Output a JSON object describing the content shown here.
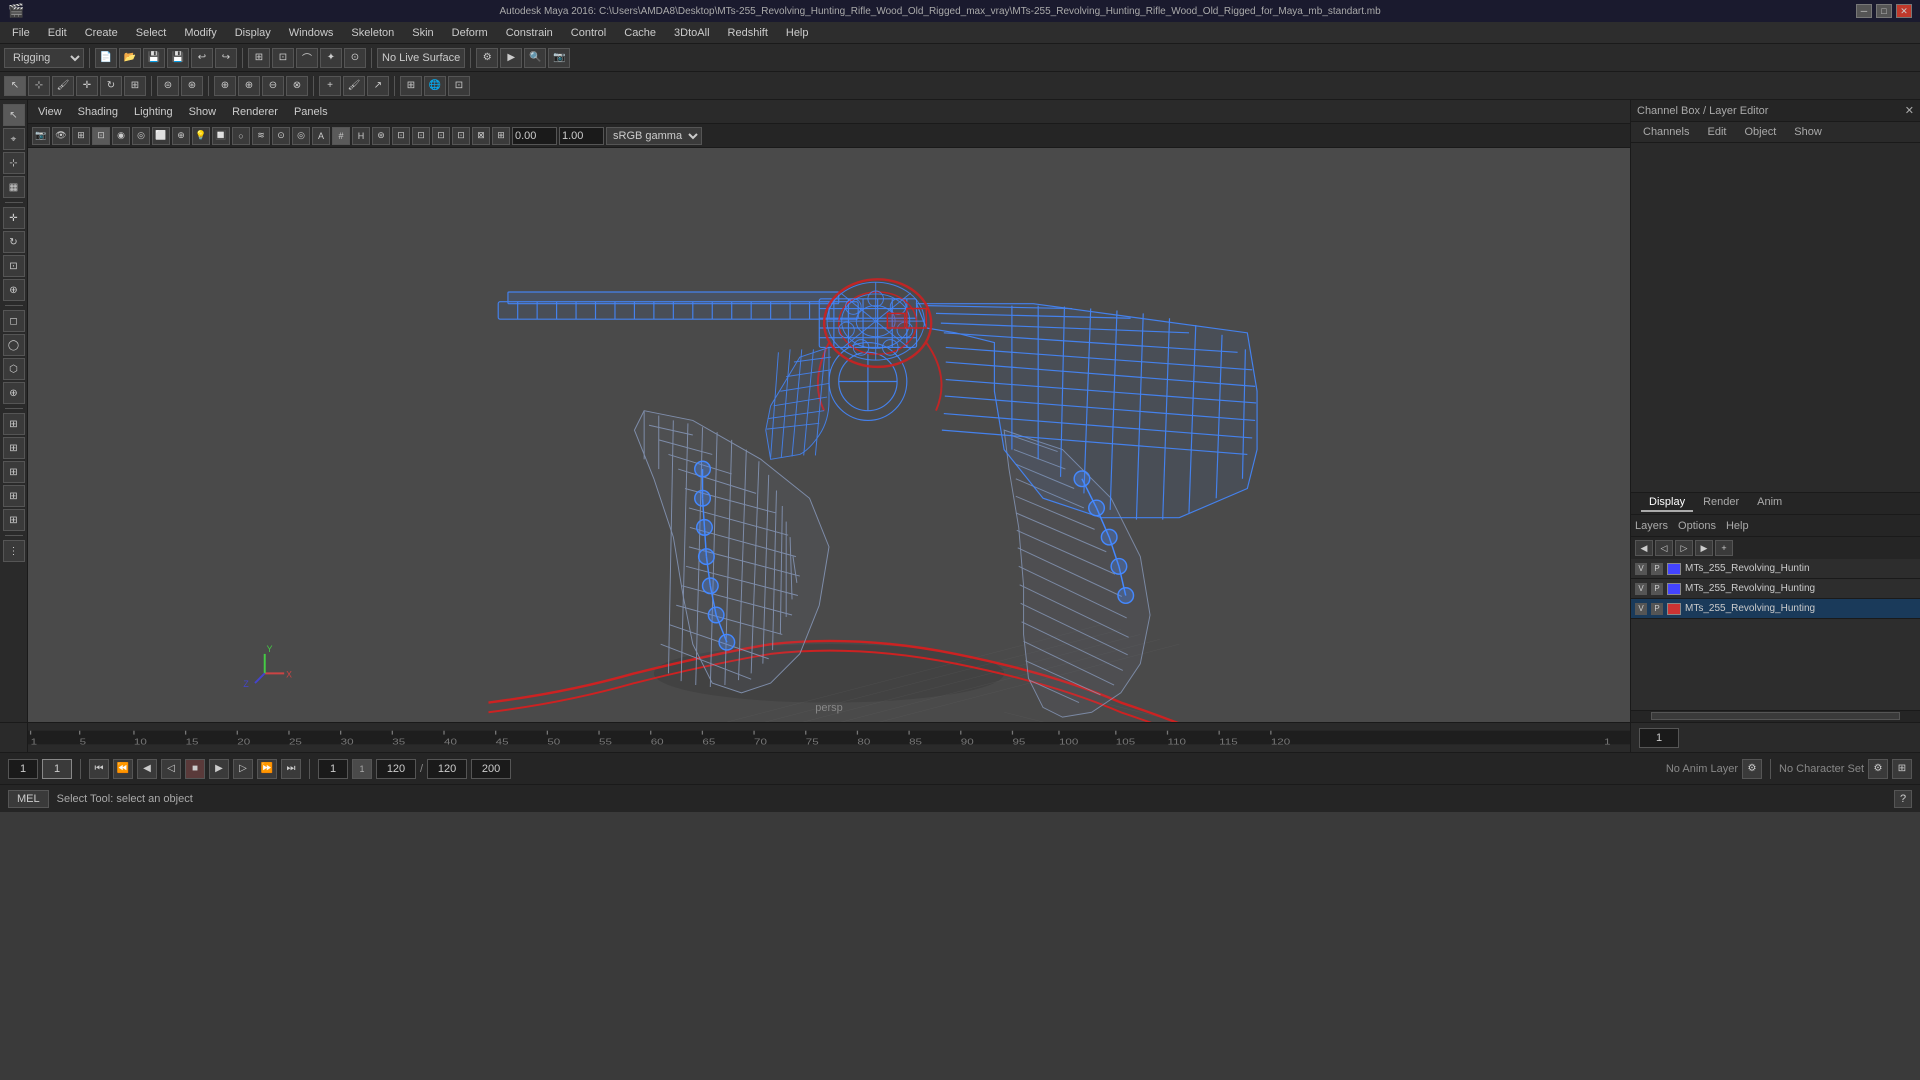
{
  "titlebar": {
    "title": "Autodesk Maya 2016: C:\\Users\\AMDA8\\Desktop\\MTs-255_Revolving_Hunting_Rifle_Wood_Old_Rigged_max_vray\\MTs-255_Revolving_Hunting_Rifle_Wood_Old_Rigged_for_Maya_mb_standart.mb",
    "min": "─",
    "max": "□",
    "close": "✕"
  },
  "menubar": {
    "items": [
      "File",
      "Edit",
      "Create",
      "Select",
      "Modify",
      "Display",
      "Windows",
      "Skeleton",
      "Skin",
      "Deform",
      "Constrain",
      "Control",
      "Cache",
      "3DtoAll",
      "Redshift",
      "Help"
    ]
  },
  "toolbar1": {
    "mode": "Rigging",
    "no_live_surface": "No Live Surface"
  },
  "viewport": {
    "menus": [
      "View",
      "Shading",
      "Lighting",
      "Show",
      "Renderer",
      "Panels"
    ],
    "persp_label": "persp",
    "value1": "0.00",
    "value2": "1.00",
    "color_space": "sRGB gamma"
  },
  "channel_box": {
    "title": "Channel Box / Layer Editor",
    "tabs": [
      "Channels",
      "Edit",
      "Object",
      "Show"
    ]
  },
  "layer_editor": {
    "tabs": [
      "Display",
      "Render",
      "Anim"
    ],
    "active_tab": "Display",
    "sub_tabs": [
      "Layers",
      "Options",
      "Help"
    ],
    "layers": [
      {
        "v": "V",
        "p": "P",
        "color": "#4444ff",
        "name": "MTs_255_Revolving_Huntin",
        "active": false
      },
      {
        "v": "V",
        "p": "P",
        "color": "#4444ff",
        "name": "MTs_255_Revolving_Hunting",
        "active": false
      },
      {
        "v": "V",
        "p": "P",
        "color": "#cc3333",
        "name": "MTs_255_Revolving_Hunting",
        "active": true
      }
    ]
  },
  "timeline": {
    "ticks": [
      "1",
      "5",
      "10",
      "15",
      "20",
      "25",
      "30",
      "35",
      "40",
      "45",
      "50",
      "55",
      "60",
      "65",
      "70",
      "75",
      "80",
      "85",
      "90",
      "95",
      "100",
      "105",
      "110",
      "115",
      "120",
      "1"
    ]
  },
  "playback": {
    "frame_start": "1",
    "frame_current": "1",
    "frame_box": "1",
    "frame_end_input": "120",
    "range_start": "1",
    "range_end": "120",
    "range_max": "200"
  },
  "statusbar": {
    "mode": "MEL",
    "status_text": "Select Tool: select an object",
    "no_anim_layer": "No Anim Layer",
    "no_char_set": "No Character Set"
  }
}
